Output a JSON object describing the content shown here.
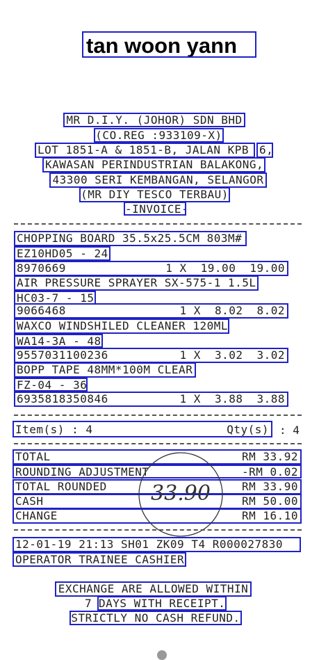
{
  "handle": "tan woon yann",
  "header": [
    "MR D.I.Y. (JOHOR) SDN BHD",
    "(CO.REG :933109-X)",
    "LOT 1851-A & 1851-B, JALAN KPB",
    "6,",
    "KAWASAN PERINDUSTRIAN BALAKONG,",
    "43300 SERI KEMBANGAN, SELANGOR",
    "(MR DIY TESCO TERBAU)",
    "-INVOICE-"
  ],
  "items": [
    {
      "name": "CHOPPING BOARD 35.5x25.5CM 803M#",
      "code": "EZ10HD05 - 24",
      "barcode": "8970669",
      "qty": "1 X",
      "price": "19.00",
      "total": "19.00"
    },
    {
      "name": "AIR PRESSURE SPRAYER SX-575-1 1.5L",
      "code": "HC03-7 - 15",
      "barcode": "9066468",
      "qty": "1 X",
      "price": "8.02",
      "total": "8.02"
    },
    {
      "name": "WAXCO WINDSHILED CLEANER 120ML",
      "code": "WA14-3A - 48",
      "barcode": "9557031100236",
      "qty": "1 X",
      "price": "3.02",
      "total": "3.02"
    },
    {
      "name": "BOPP TAPE 48MM*100M CLEAR",
      "code": "FZ-04 - 36",
      "barcode": "6935818350846",
      "qty": "1 X",
      "price": "3.88",
      "total": "3.88"
    }
  ],
  "counts": {
    "items_label": "Item(s) : 4",
    "qty_label": "Qty(s)",
    "qty_value": ": 4"
  },
  "totals": [
    {
      "label": "TOTAL",
      "value": "RM 33.92"
    },
    {
      "label": "ROUNDING ADJUSTMENT",
      "value": "-RM 0.02"
    },
    {
      "label": "TOTAL ROUNDED",
      "value": "RM 33.90"
    },
    {
      "label": "CASH",
      "value": "RM 50.00"
    },
    {
      "label": "CHANGE",
      "value": "RM 16.10"
    }
  ],
  "handwritten_note": "33.90",
  "footer_meta": {
    "stamp": "12-01-19 21:13 SH01 ZK09   T4 R000027830",
    "operator": "OPERATOR TRAINEE CASHIER"
  },
  "policy": [
    "EXCHANGE ARE ALLOWED WITHIN",
    "7",
    "DAYS WITH RECEIPT.",
    "STRICTLY NO CASH REFUND."
  ],
  "colors": {
    "box": "#1f22c8",
    "ink": "#222222"
  }
}
